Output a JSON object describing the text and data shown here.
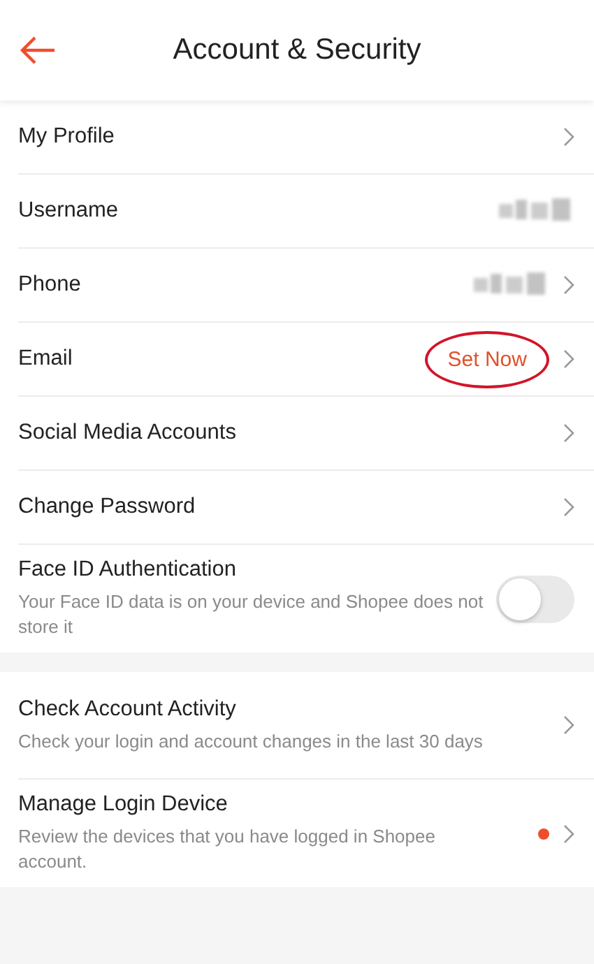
{
  "header": {
    "title": "Account & Security"
  },
  "sections": [
    {
      "rows": [
        {
          "kind": "link",
          "label": "My Profile",
          "chevron": true
        },
        {
          "kind": "link",
          "label": "Username",
          "redacted": true,
          "chevron": false
        },
        {
          "kind": "link",
          "label": "Phone",
          "redacted": true,
          "chevron": true
        },
        {
          "kind": "link",
          "label": "Email",
          "value": "Set Now",
          "circled": true,
          "chevron": true
        },
        {
          "kind": "link",
          "label": "Social Media Accounts",
          "chevron": true
        },
        {
          "kind": "link",
          "label": "Change Password",
          "chevron": true
        },
        {
          "kind": "toggle",
          "label": "Face ID Authentication",
          "description": "Your Face ID data is on your device and Shopee does not store it",
          "on": false
        }
      ]
    },
    {
      "rows": [
        {
          "kind": "link",
          "label": "Check Account Activity",
          "description": "Check your login and account changes in the last 30 days",
          "chevron": true
        },
        {
          "kind": "link",
          "label": "Manage Login Device",
          "description": "Review the devices that you have logged in Shopee account.",
          "alert_dot": true,
          "chevron": true
        }
      ]
    }
  ]
}
